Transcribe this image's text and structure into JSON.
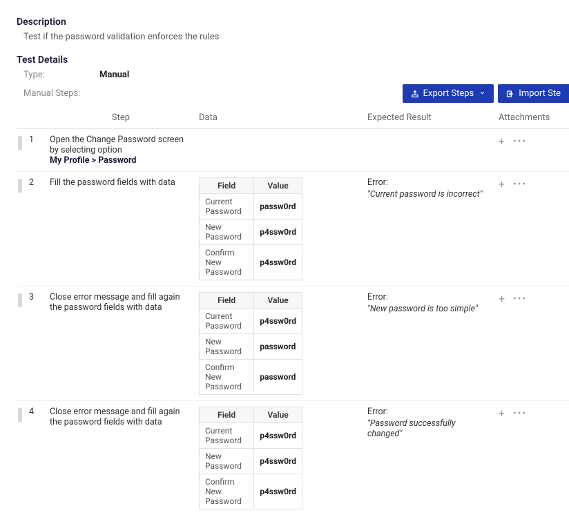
{
  "description": {
    "title": "Description",
    "text": "Test if the password validation enforces the rules"
  },
  "details": {
    "title": "Test Details",
    "type_label": "Type:",
    "type_value": "Manual",
    "steps_label": "Manual Steps:"
  },
  "buttons": {
    "export": "Export Steps",
    "import": "Import Ste"
  },
  "headers": {
    "step": "Step",
    "data": "Data",
    "expected": "Expected Result",
    "attachments": "Attachments"
  },
  "data_table_headers": {
    "field": "Field",
    "value": "Value"
  },
  "steps": [
    {
      "num": "1",
      "text": "Open the Change Password screen by selecting option",
      "bold_path": "My Profile > Password",
      "data_rows": [],
      "expected_title": "",
      "expected_msg": ""
    },
    {
      "num": "2",
      "text": "Fill the password fields with data",
      "bold_path": "",
      "data_rows": [
        {
          "label": "Current Password",
          "value": "passw0rd"
        },
        {
          "label": "New Password",
          "value": "p4ssw0rd"
        },
        {
          "label": "Confirm New Password",
          "value": "p4ssw0rd"
        }
      ],
      "expected_title": "Error:",
      "expected_msg": "\"Current password is incorrect\""
    },
    {
      "num": "3",
      "text": "Close error message and fill again the password fields with data",
      "bold_path": "",
      "data_rows": [
        {
          "label": "Current Password",
          "value": "p4ssw0rd"
        },
        {
          "label": "New Password",
          "value": "password"
        },
        {
          "label": "Confirm New Password",
          "value": "password"
        }
      ],
      "expected_title": "Error:",
      "expected_msg": "\"New password is too simple\""
    },
    {
      "num": "4",
      "text": "Close error message and fill again the password fields with data",
      "bold_path": "",
      "data_rows": [
        {
          "label": "Current Password",
          "value": "p4ssw0rd"
        },
        {
          "label": "New Password",
          "value": "p4ssw0rd"
        },
        {
          "label": "Confirm New Password",
          "value": "p4ssw0rd"
        }
      ],
      "expected_title": "Error:",
      "expected_msg": "\"Password successfully changed\""
    }
  ]
}
